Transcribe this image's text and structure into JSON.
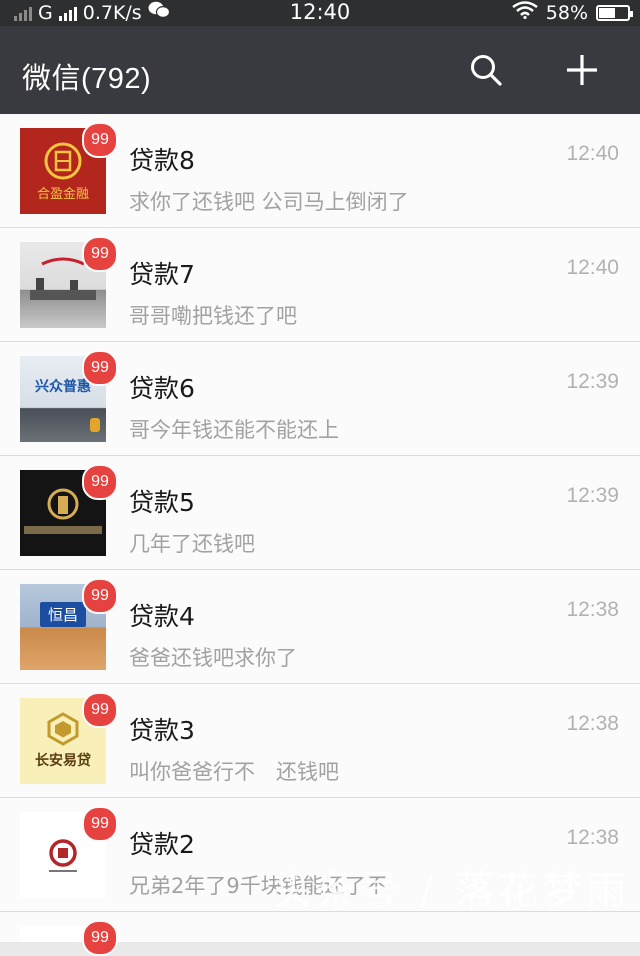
{
  "status_bar": {
    "network_type": "G",
    "speed": "0.7K/s",
    "time": "12:40",
    "battery": "58%",
    "battery_level": 0.58
  },
  "header": {
    "title": "微信(792)",
    "search_icon": "search-icon",
    "add_icon": "plus-icon"
  },
  "chats": [
    {
      "name": "贷款8",
      "message": "求你了还钱吧 公司马上倒闭了",
      "time": "12:40",
      "badge": "99",
      "avatar_text": "合盈金融"
    },
    {
      "name": "贷款7",
      "message": "哥哥嘞把钱还了吧",
      "time": "12:40",
      "badge": "99",
      "avatar_text": ""
    },
    {
      "name": "贷款6",
      "message": "哥今年钱还能不能还上",
      "time": "12:39",
      "badge": "99",
      "avatar_text": "兴众普惠"
    },
    {
      "name": "贷款5",
      "message": "几年了还钱吧",
      "time": "12:39",
      "badge": "99",
      "avatar_text": ""
    },
    {
      "name": "贷款4",
      "message": "爸爸还钱吧求你了",
      "time": "12:38",
      "badge": "99",
      "avatar_text": "恒昌"
    },
    {
      "name": "贷款3",
      "message": "叫你爸爸行不　还钱吧",
      "time": "12:38",
      "badge": "99",
      "avatar_text": "长安易贷"
    },
    {
      "name": "贷款2",
      "message": "兄弟2年了9千块钱能还了不",
      "time": "12:38",
      "badge": "99",
      "avatar_text": ""
    },
    {
      "name": "",
      "message": "",
      "time": "",
      "badge": "99",
      "avatar_text": ""
    }
  ],
  "watermark": "头条号 / 落花梦雨",
  "colors": {
    "header_bg": "#393a3f",
    "badge": "#e64340",
    "row_bg": "#fbfbfb"
  }
}
